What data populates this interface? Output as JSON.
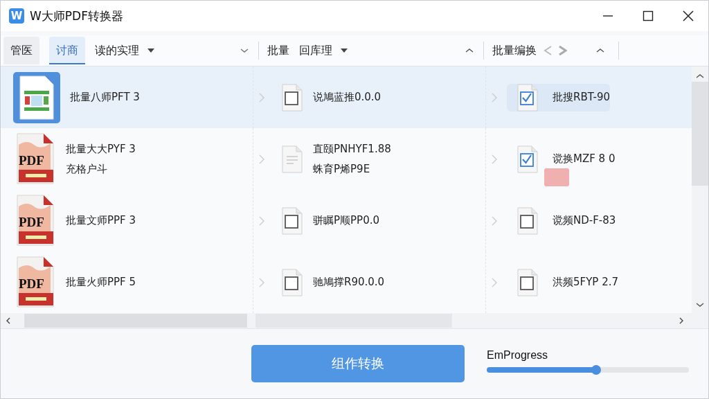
{
  "window": {
    "logo": "W",
    "title": "W大师PDF转换器"
  },
  "toolbar": {
    "tabs": [
      {
        "label": "管医",
        "selected": false
      },
      {
        "label": "讨商",
        "selected": true
      }
    ],
    "section_1": {
      "dropdown": "读的实理"
    },
    "section_2": {
      "label": "批量",
      "dropdown": "回库理"
    },
    "section_3": {
      "label": "批量编换"
    }
  },
  "rows": [
    {
      "selected": true,
      "file": {
        "kind": "image",
        "lines": [
          "批量八师PFT 3"
        ]
      },
      "middle": {
        "kind": "checkbox",
        "checked": false,
        "lines": [
          "说鳩蓝推0.0.0"
        ]
      },
      "right": {
        "checked": true,
        "highlighted": true,
        "lines": [
          "批搜RBT-90"
        ]
      }
    },
    {
      "selected": false,
      "file": {
        "kind": "pdf",
        "badge": "PDF",
        "lines": [
          "批量大大PYF 3",
          "充格户斗"
        ]
      },
      "middle": {
        "kind": "document",
        "lines": [
          "直颐PNHYF1.88",
          "蛛育P烯P9E"
        ]
      },
      "right": {
        "checked": true,
        "highlighted": false,
        "stamp": true,
        "lines": [
          "谠换MZF 8 0"
        ]
      }
    },
    {
      "selected": false,
      "file": {
        "kind": "pdf",
        "badge": "PDF",
        "lines": [
          "批量文师PPF 3"
        ]
      },
      "middle": {
        "kind": "checkbox",
        "checked": false,
        "lines": [
          "骈瞩P顺PP0.0"
        ]
      },
      "right": {
        "checked": false,
        "highlighted": false,
        "lines": [
          "谠频ND-F-83"
        ]
      }
    },
    {
      "selected": false,
      "file": {
        "kind": "pdf",
        "badge": "PDF",
        "lines": [
          "批量火师PPF 5"
        ]
      },
      "middle": {
        "kind": "checkbox",
        "checked": false,
        "lines": [
          "驰鳩撑R90.0.0"
        ]
      },
      "right": {
        "checked": false,
        "highlighted": false,
        "lines": [
          "洪频5FYP 2.7"
        ]
      }
    }
  ],
  "footer": {
    "convert_button": "组作转换",
    "progress": {
      "label": "EmProgress",
      "level": 0.54
    }
  }
}
